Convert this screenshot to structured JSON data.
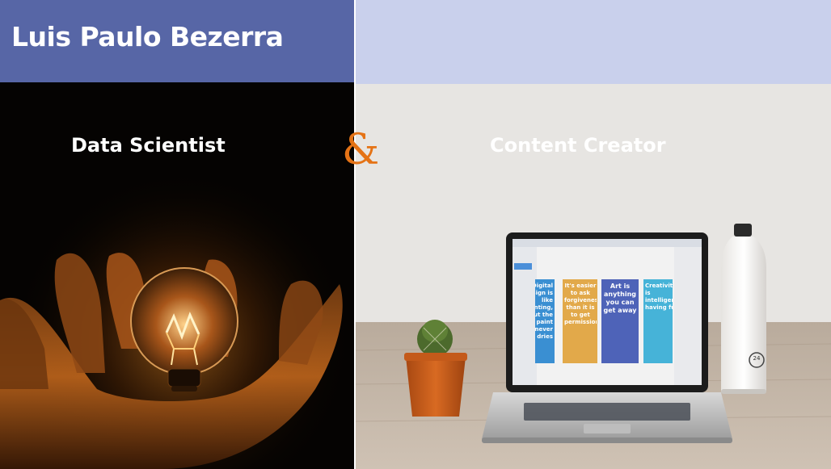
{
  "header": {
    "title": "Luis Paulo Bezerra"
  },
  "roles": {
    "left": "Data Scientist",
    "separator": "&",
    "right": "Content Creator"
  },
  "laptop_posters": [
    "Digital design is like painting, but the paint never dries",
    "It's easier to ask forgiveness than it is to get permission",
    "Art is anything you can get away",
    "Creativity is intelligence having fun"
  ],
  "bottle_badge": "24",
  "colors": {
    "header_left": "#5766a6",
    "header_right": "#c9d0ec",
    "ampersand": "#e57316"
  }
}
